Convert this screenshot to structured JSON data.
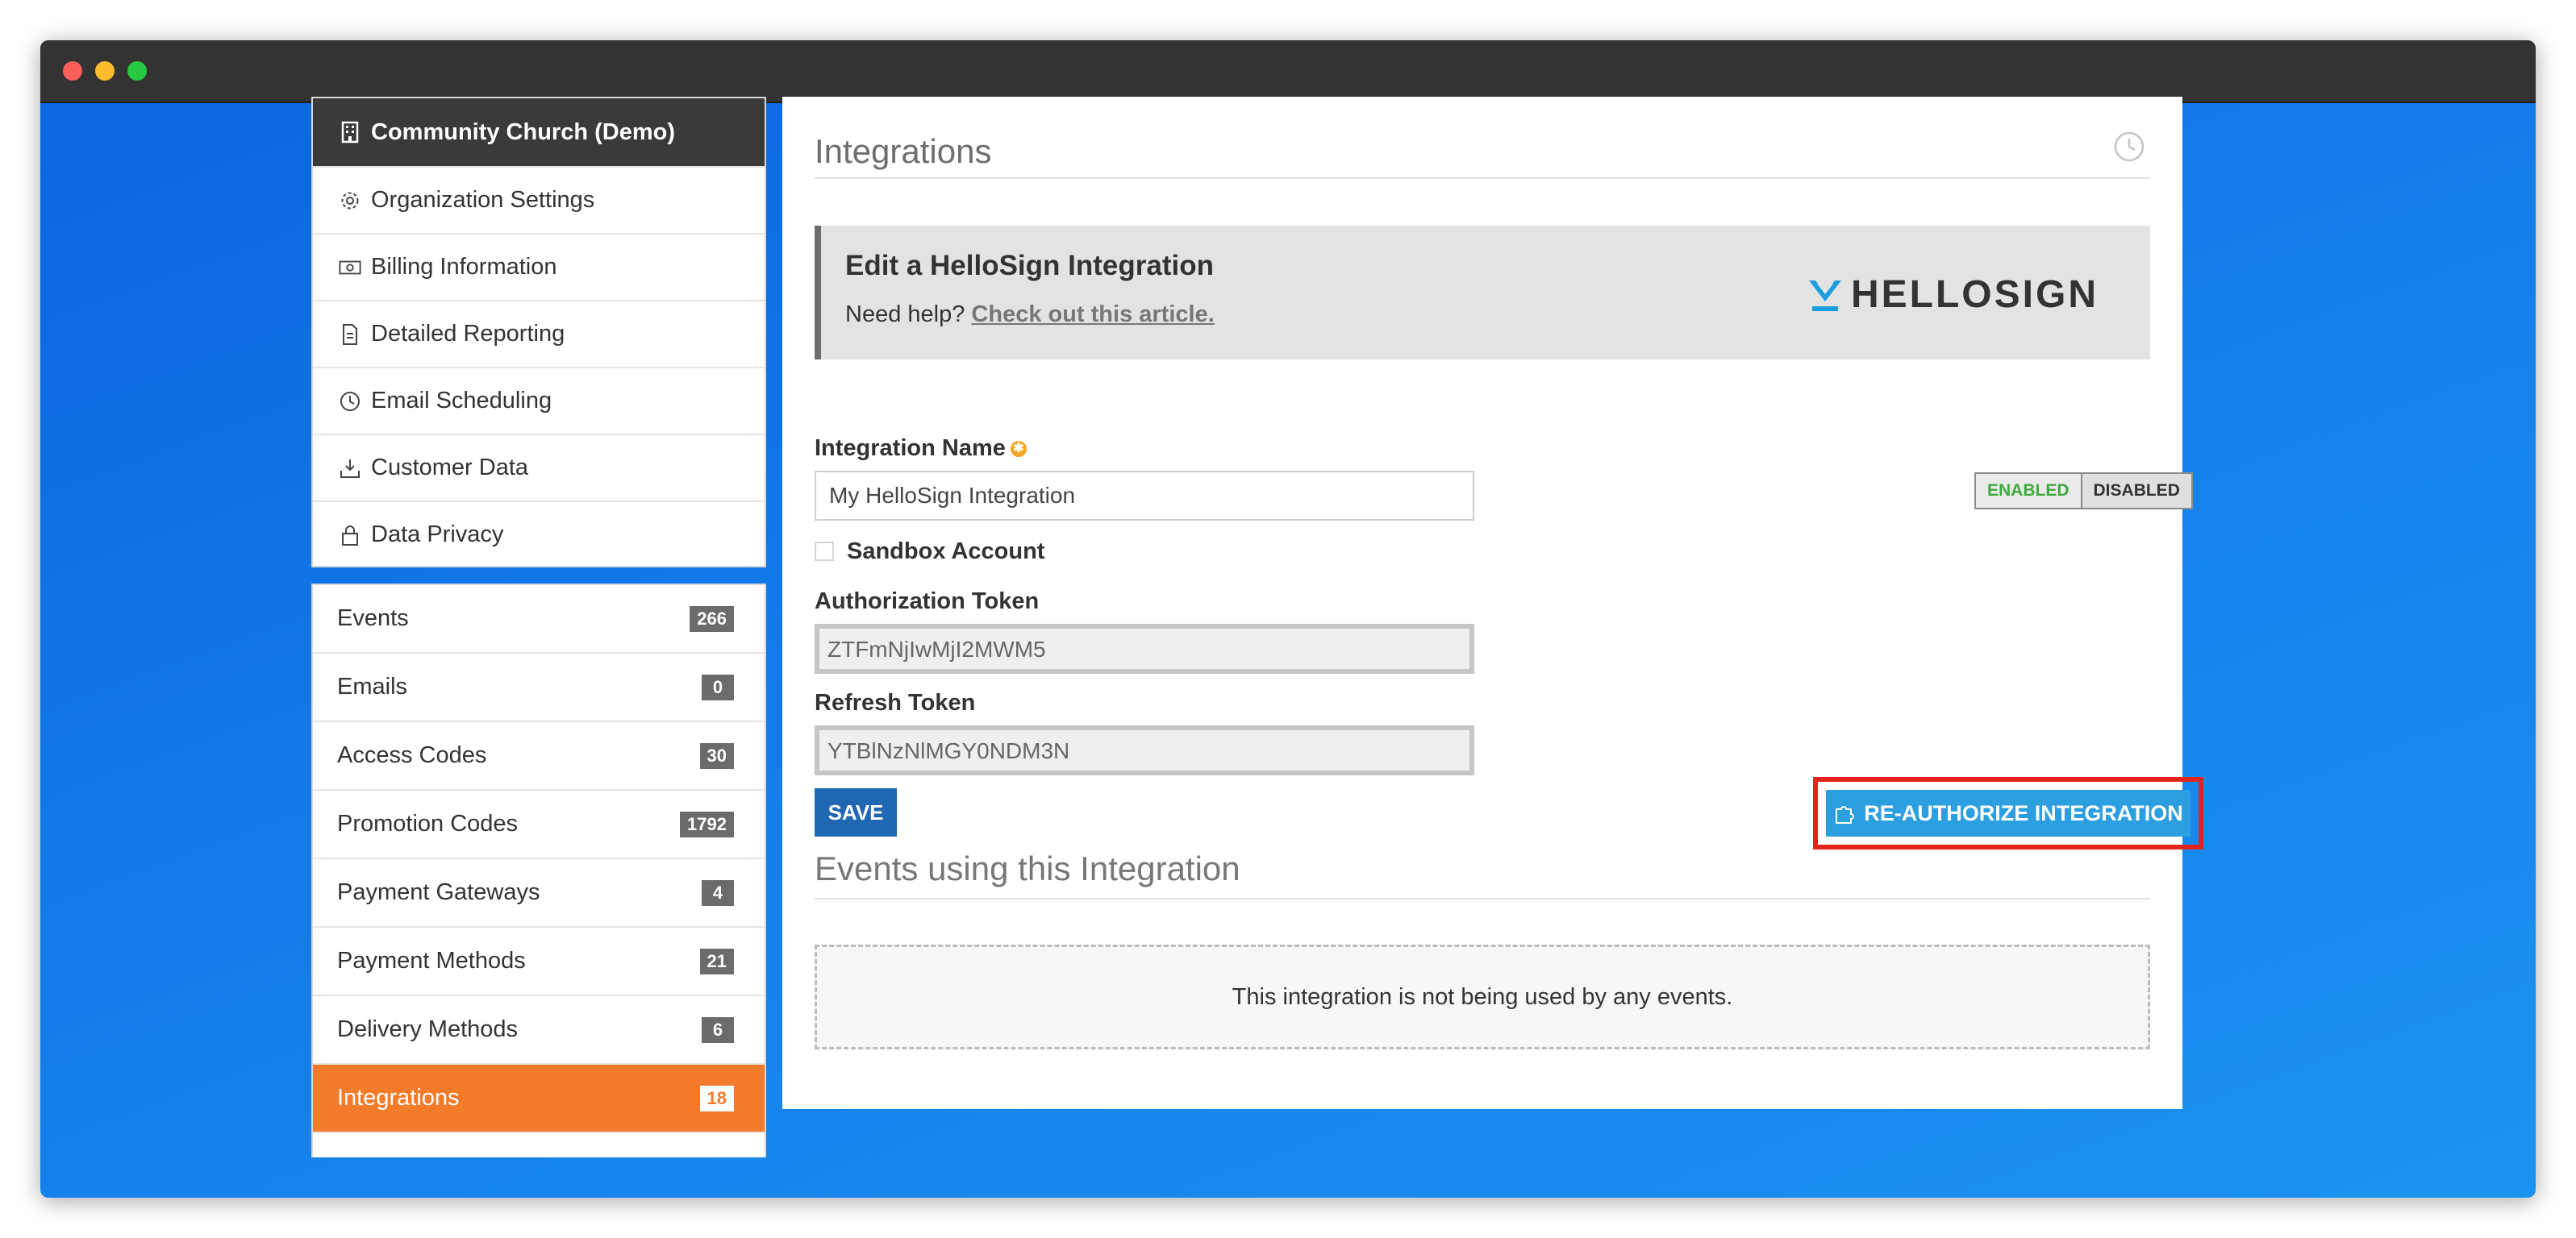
{
  "window": {
    "controls": [
      "close",
      "minimize",
      "zoom"
    ]
  },
  "org_menu": {
    "header": {
      "label": "Community Church (Demo)",
      "icon": "building-icon"
    },
    "items": [
      {
        "label": "Organization Settings",
        "icon": "gear-icon"
      },
      {
        "label": "Billing Information",
        "icon": "banknote-icon"
      },
      {
        "label": "Detailed Reporting",
        "icon": "document-icon"
      },
      {
        "label": "Email Scheduling",
        "icon": "clock-icon"
      },
      {
        "label": "Customer Data",
        "icon": "download-tray-icon"
      },
      {
        "label": "Data Privacy",
        "icon": "lock-icon"
      }
    ]
  },
  "nav_menu": {
    "items": [
      {
        "label": "Events",
        "count": "266"
      },
      {
        "label": "Emails",
        "count": "0"
      },
      {
        "label": "Access Codes",
        "count": "30"
      },
      {
        "label": "Promotion Codes",
        "count": "1792"
      },
      {
        "label": "Payment Gateways",
        "count": "4"
      },
      {
        "label": "Payment Methods",
        "count": "21"
      },
      {
        "label": "Delivery Methods",
        "count": "6"
      },
      {
        "label": "Integrations",
        "count": "18",
        "active": true
      }
    ]
  },
  "main": {
    "page_title": "Integrations",
    "history_icon": "history-clock-icon",
    "banner": {
      "title": "Edit a HelloSign Integration",
      "help_prefix": "Need help? ",
      "help_link": "Check out this article.",
      "brand": "HELLOSIGN"
    },
    "form": {
      "name_label": "Integration Name",
      "name_value": "My HelloSign Integration",
      "status_enabled": "ENABLED",
      "status_disabled": "DISABLED",
      "status_selected": "ENABLED",
      "sandbox_label": "Sandbox Account",
      "sandbox_checked": false,
      "auth_token_label": "Authorization Token",
      "auth_token_value": "ZTFmNjIwMjI2MWM5",
      "refresh_token_label": "Refresh Token",
      "refresh_token_value": "YTBlNzNlMGY0NDM3N",
      "save_label": "SAVE",
      "reauth_label": "RE-AUTHORIZE INTEGRATION"
    },
    "events_section": {
      "title": "Events using this Integration",
      "empty_message": "This integration is not being used by any events."
    }
  },
  "colors": {
    "active_menu": "#f47b2a",
    "save_button": "#1f67b3",
    "reauth_button": "#2b9fe0",
    "highlight_border": "#e0261a",
    "enabled_text": "#3fa83f",
    "brand_accent": "#1a9ee0"
  }
}
